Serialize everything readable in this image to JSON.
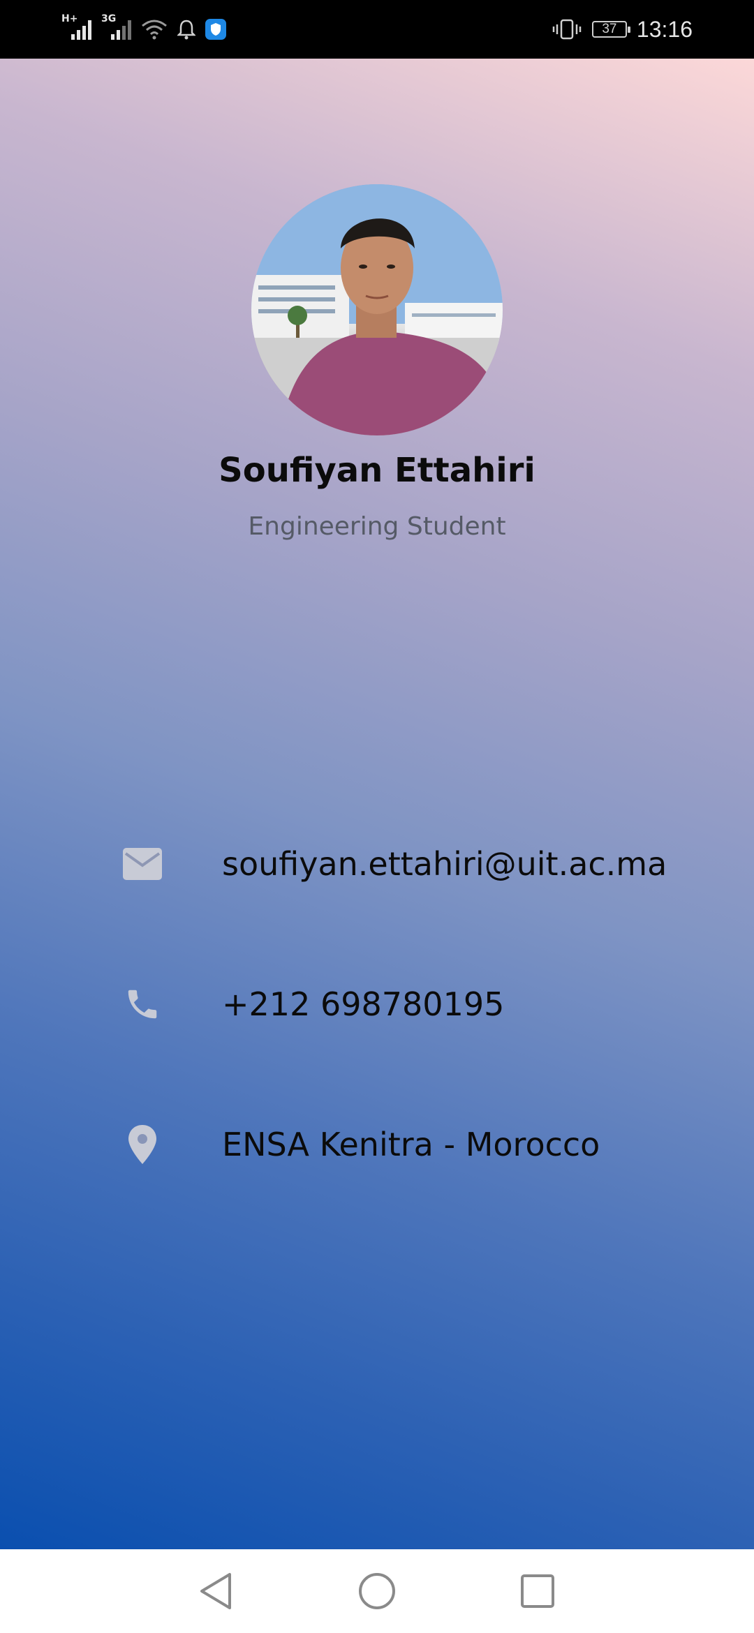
{
  "status_bar": {
    "network_1_label": "H+",
    "network_2_label": "3G",
    "battery_level": "37",
    "time": "13:16",
    "icons": [
      "signal-icon",
      "signal-icon",
      "wifi-icon",
      "notification-bell-icon",
      "shield-icon",
      "vibrate-icon",
      "battery-icon"
    ]
  },
  "profile": {
    "name": "Soufiyan Ettahiri",
    "title": "Engineering Student",
    "photo_icon": "profile-photo"
  },
  "contact": {
    "email": "soufiyan.ettahiri@uit.ac.ma",
    "phone": "+212 698780195",
    "location": "ENSA Kenitra - Morocco",
    "icon_color": "#c8cbd6"
  },
  "nav_bar": {
    "icons": [
      "back-icon",
      "home-icon",
      "recents-icon"
    ]
  },
  "colors": {
    "gradient_top": "#fcd8d8",
    "gradient_bottom": "#0a4faf"
  }
}
